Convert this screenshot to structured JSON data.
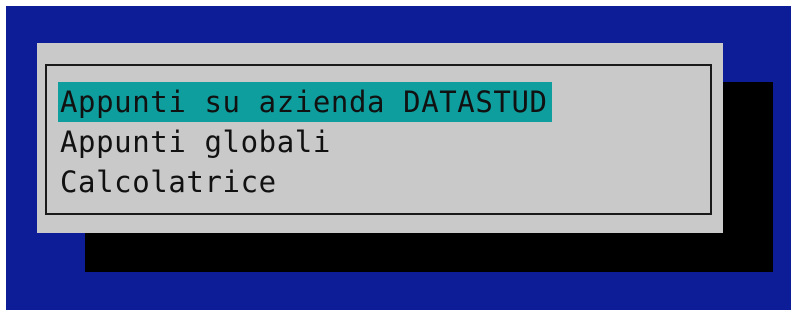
{
  "colors": {
    "screen_background": "#0c1d97",
    "dialog_background": "#c9c9c9",
    "shadow": "#000000",
    "selection_highlight": "#0f9e9e",
    "text": "#111111"
  },
  "menu": {
    "selected_index": 0,
    "items": [
      {
        "label": "Appunti su azienda DATASTUD"
      },
      {
        "label": "Appunti globali"
      },
      {
        "label": "Calcolatrice"
      }
    ]
  }
}
